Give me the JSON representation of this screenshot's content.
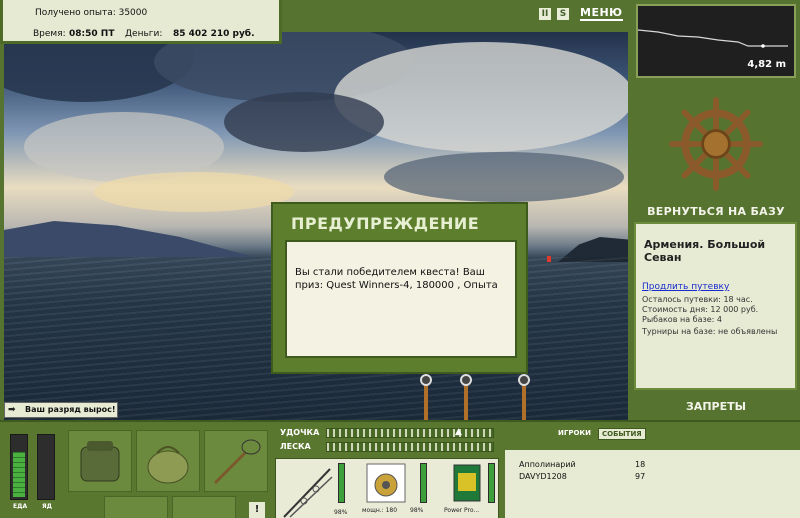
{
  "info": {
    "experience": "Получено опыта: 35000",
    "time_label": "Время:",
    "time_value": "08:50 ПТ",
    "money_label": "Деньги:",
    "money_value": "85 402 210 руб."
  },
  "top": {
    "pause_icon": "II",
    "sound_icon": "S",
    "menu_label": "МЕНЮ"
  },
  "depth": {
    "value": "4,82 m"
  },
  "right": {
    "return_label": "ВЕРНУТЬСЯ НА БАЗУ",
    "bans_label": "ЗАПРЕТЫ"
  },
  "location": {
    "title": "Армения. Большой Севан",
    "extend_link": "Продлить путевку",
    "lines": [
      "Осталось путевки: 18 час.",
      "Стоимость дня: 12 000 руб.",
      "Рыбаков на базе: 4",
      "Турниры на базе: не объявлены"
    ]
  },
  "dialog": {
    "title": "ПРЕДУПРЕЖДЕНИЕ",
    "message": "Вы стали победителем квеста! Ваш приз: Quest Winners-4, 180000 , Опыта"
  },
  "toast": {
    "text": "Ваш разряд вырос!"
  },
  "bottom": {
    "food_label": "ЕДА",
    "food_level": 0.72,
    "poison_label": "ЯД",
    "poison_level": 0.0,
    "rod_label": "УДОЧКА",
    "line_label": "ЛЕСКА",
    "reel_caption": "мощн.: 180",
    "reel_percent": "98%",
    "bait_caption": "Power Pro...",
    "rod_percent": "98%",
    "exclaim": "!"
  },
  "players": {
    "tabs": [
      "ИГРОКИ",
      "СОБЫТИЯ"
    ],
    "active_tab": 1,
    "rows": [
      {
        "name": "Апполинарий",
        "score": "18"
      },
      {
        "name": "DAVYD1208",
        "score": "97"
      }
    ]
  }
}
